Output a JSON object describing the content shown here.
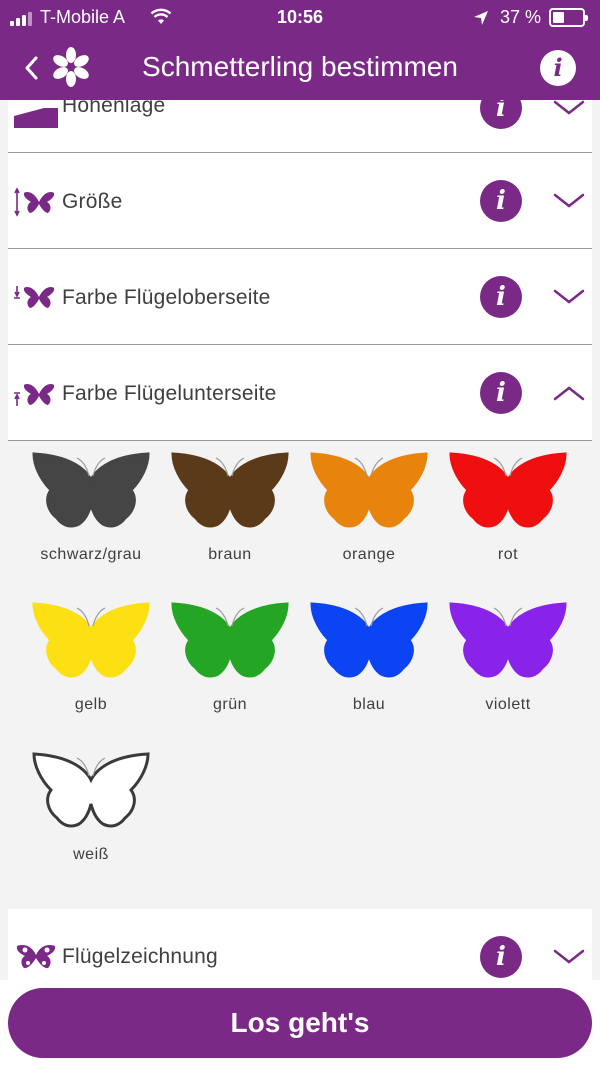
{
  "status": {
    "carrier": "T-Mobile A",
    "time": "10:56",
    "battery": "37 %"
  },
  "nav": {
    "title": "Schmetterling bestimmen",
    "info_glyph": "i"
  },
  "rows": {
    "partial": {
      "label": "Höhenlage",
      "icon": "mountain-icon"
    },
    "size": {
      "label": "Größe",
      "icon": "butterfly-size-icon"
    },
    "upper": {
      "label": "Farbe Flügeloberseite",
      "icon": "butterfly-upper-icon"
    },
    "lower": {
      "label": "Farbe Flügelunterseite",
      "icon": "butterfly-lower-icon"
    },
    "pattern": {
      "label": "Flügelzeichnung",
      "icon": "butterfly-pattern-icon"
    }
  },
  "info_glyph": "i",
  "colors": [
    {
      "name": "schwarz/grau",
      "hex": "#454545"
    },
    {
      "name": "braun",
      "hex": "#5b3a1a"
    },
    {
      "name": "orange",
      "hex": "#e8840c"
    },
    {
      "name": "rot",
      "hex": "#f00f0f"
    },
    {
      "name": "gelb",
      "hex": "#fce013"
    },
    {
      "name": "grün",
      "hex": "#25a524"
    },
    {
      "name": "blau",
      "hex": "#0b44f2"
    },
    {
      "name": "violett",
      "hex": "#8a23ea"
    },
    {
      "name": "weiß",
      "hex": "#ffffff"
    }
  ],
  "accent": "#7a2a86",
  "button": {
    "label": "Los geht's"
  }
}
